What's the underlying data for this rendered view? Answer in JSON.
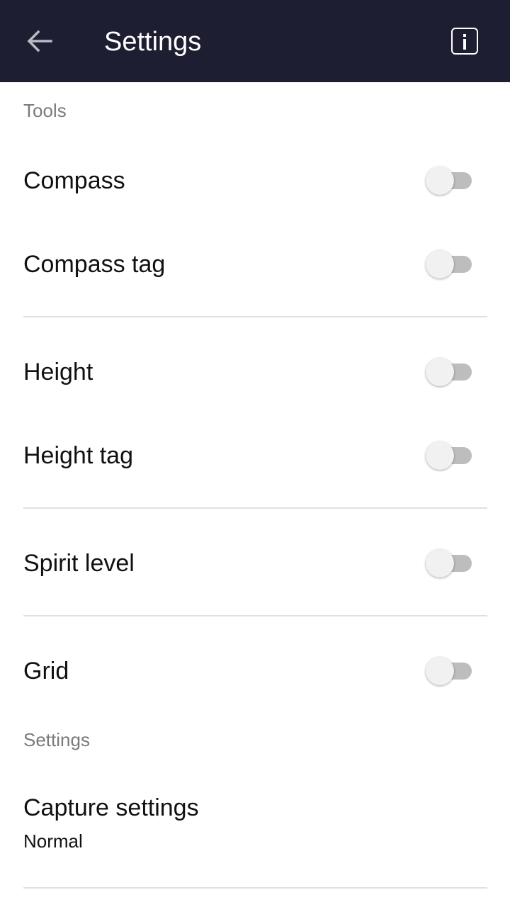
{
  "appbar": {
    "title": "Settings",
    "back_icon": "arrow-left-icon",
    "info_icon": "info-icon",
    "background_color": "#1d1e31"
  },
  "sections": {
    "tools_header": "Tools",
    "settings_header": "Settings"
  },
  "toggles": [
    {
      "label": "Compass",
      "on": false
    },
    {
      "label": "Compass tag",
      "on": false
    },
    {
      "label": "Height",
      "on": false
    },
    {
      "label": "Height tag",
      "on": false
    },
    {
      "label": "Spirit level",
      "on": false
    },
    {
      "label": "Grid",
      "on": false
    }
  ],
  "capture_settings": {
    "label": "Capture settings",
    "value": "Normal"
  }
}
